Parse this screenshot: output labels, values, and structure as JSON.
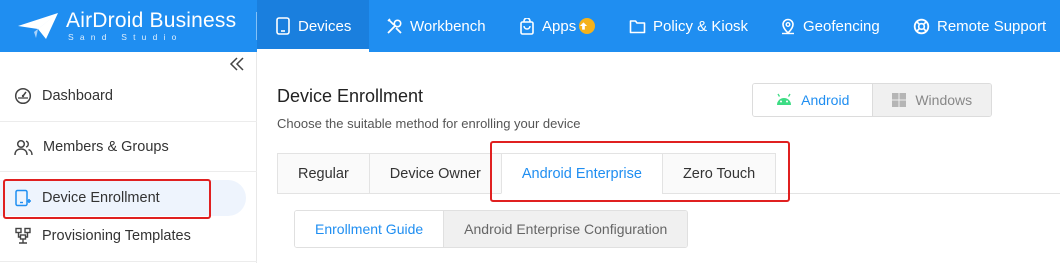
{
  "brand": {
    "title": "AirDroid Business",
    "subtitle": "Sand Studio",
    "primary_color": "#1f8ef1"
  },
  "topnav": {
    "items": [
      {
        "label": "Devices",
        "icon": "phone-icon",
        "active": true
      },
      {
        "label": "Workbench",
        "icon": "tools-icon",
        "active": false
      },
      {
        "label": "Apps",
        "icon": "bag-icon",
        "active": false,
        "badge": "arrow-up-icon"
      },
      {
        "label": "Policy & Kiosk",
        "icon": "folder-icon",
        "active": false
      },
      {
        "label": "Geofencing",
        "icon": "location-icon",
        "active": false
      },
      {
        "label": "Remote Support",
        "icon": "lifebuoy-icon",
        "active": false
      }
    ]
  },
  "sidebar": {
    "items": [
      {
        "label": "Dashboard",
        "icon": "dashboard-icon"
      },
      {
        "label": "Members & Groups",
        "icon": "users-icon"
      },
      {
        "label": "Device Enrollment",
        "icon": "device-add-icon",
        "active": true
      },
      {
        "label": "Provisioning Templates",
        "icon": "template-icon"
      }
    ]
  },
  "main": {
    "title": "Device Enrollment",
    "subtitle": "Choose the suitable method for enrolling your device",
    "os_toggle": {
      "android": "Android",
      "windows": "Windows",
      "selected": "Android"
    },
    "tabs": [
      {
        "label": "Regular"
      },
      {
        "label": "Device Owner"
      },
      {
        "label": "Android Enterprise",
        "active": true
      },
      {
        "label": "Zero Touch"
      }
    ],
    "sub_tabs": [
      {
        "label": "Enrollment Guide",
        "active": true
      },
      {
        "label": "Android Enterprise Configuration"
      }
    ]
  },
  "highlight_color": "#e02020"
}
